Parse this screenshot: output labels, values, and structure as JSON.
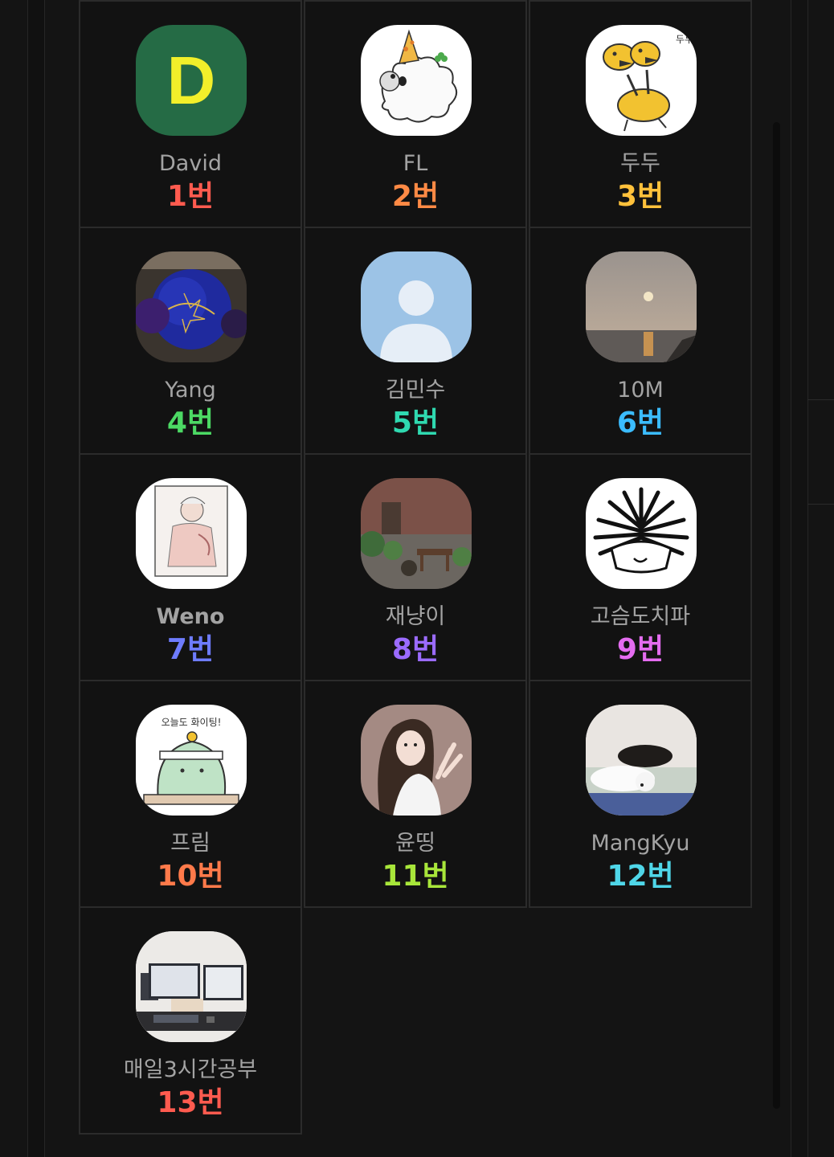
{
  "members": [
    {
      "name": "David",
      "number": "1번",
      "color": "#ff5b4f",
      "avatar": "letter-d-avatar",
      "letter": "D"
    },
    {
      "name": "FL",
      "number": "2번",
      "color": "#ff8a45",
      "avatar": "party-dog-avatar"
    },
    {
      "name": "두두",
      "number": "3번",
      "color": "#ffc13b",
      "avatar": "doduo-avatar"
    },
    {
      "name": "Yang",
      "number": "4번",
      "color": "#4cd964",
      "avatar": "bowling-ball-avatar"
    },
    {
      "name": "김민수",
      "number": "5번",
      "color": "#2fd9b0",
      "avatar": "default-person-avatar"
    },
    {
      "name": "10M",
      "number": "6번",
      "color": "#3bbcff",
      "avatar": "sunset-sea-avatar"
    },
    {
      "name": "Weno",
      "number": "7번",
      "color": "#6e7cff",
      "avatar": "manga-character-avatar"
    },
    {
      "name": "재냥이",
      "number": "8번",
      "color": "#9b6bff",
      "avatar": "garden-courtyard-avatar"
    },
    {
      "name": "고슴도치파",
      "number": "9번",
      "color": "#e46cf0",
      "avatar": "hedgehog-avatar"
    },
    {
      "name": "프림",
      "number": "10번",
      "color": "#ff7a4a",
      "avatar": "green-dino-avatar"
    },
    {
      "name": "윤띵",
      "number": "11번",
      "color": "#a8e63a",
      "avatar": "waving-girl-avatar"
    },
    {
      "name": "MangKyu",
      "number": "12번",
      "color": "#4fd6e8",
      "avatar": "sleeping-dogs-avatar"
    },
    {
      "name": "매일3시간공부",
      "number": "13번",
      "color": "#ff5b4f",
      "avatar": "desk-monitors-avatar"
    }
  ]
}
